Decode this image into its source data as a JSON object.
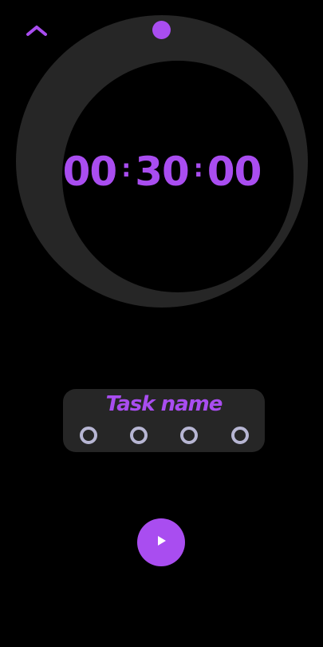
{
  "icons": {
    "collapse": "chevron-up-icon",
    "play": "play-icon",
    "session": "ring-icon"
  },
  "colors": {
    "background": "#000000",
    "accent": "#a94df0",
    "surface": "#262626",
    "session_dot": "#b7b6d3"
  },
  "timer": {
    "hours": "00",
    "minutes": "30",
    "seconds": "00",
    "separator": ":"
  },
  "task": {
    "name": "Task name",
    "sessions": 4
  }
}
